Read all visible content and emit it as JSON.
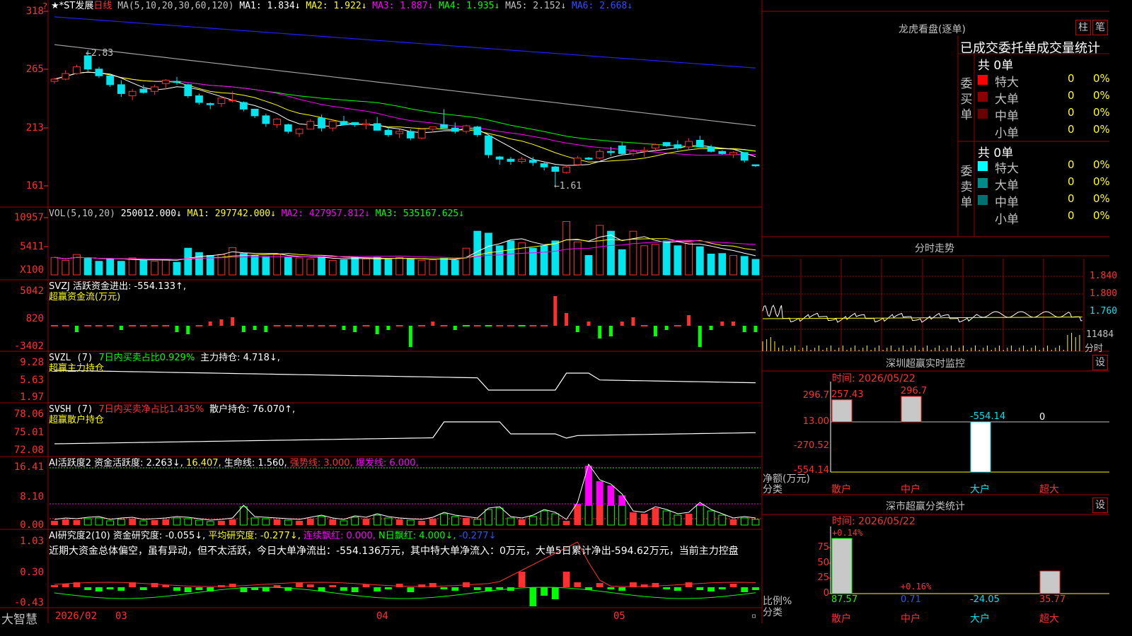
{
  "colors": {
    "up": "#ff3030",
    "down": "#00e5ee",
    "grid": "#9a0000",
    "yellow": "#ffff00",
    "magenta": "#ff00ff",
    "green": "#00ff00",
    "white": "#ffffff",
    "blue": "#2020ff",
    "gray": "#a0a0a0"
  },
  "header": {
    "stock_name": "★*ST发展",
    "period": "日线",
    "ma_label": "MA(5,10,20,30,60,120)",
    "ma1": "MA1: 1.834↓",
    "ma2": "MA2: 1.922↓",
    "ma3": "MA3: 1.887↓",
    "ma4": "MA4: 1.935↓",
    "ma5": "MA5: 2.152↓",
    "ma6": "MA6: 2.668↓"
  },
  "price_axis": [
    "318",
    "265",
    "213",
    "161"
  ],
  "price_annotations": {
    "high": "2.83",
    "low": "1.61"
  },
  "volume_panel": {
    "legend": "VOL(5,10,20)",
    "value": "250012.000↓",
    "ma1": "MA1: 297742.000↓",
    "ma2": "MA2: 427957.812↓",
    "ma3": "MA3: 535167.625↓",
    "axis": [
      "10957",
      "5411"
    ],
    "unit": "X100"
  },
  "svzj_panel": {
    "legend": "SVZJ  活跃资金进出: -554.133↑,",
    "sub": "超赢资金流(万元)",
    "axis": [
      "5042",
      "820",
      "-3402"
    ]
  },
  "svzl_panel": {
    "legend_a": "SVZL (7)",
    "legend_b": "7日内买卖占比0.929%",
    "legend_c": "主力持仓: 4.718↓,",
    "sub": "超赢主力持仓",
    "axis": [
      "9.28",
      "5.63",
      "1.97"
    ]
  },
  "svsh_panel": {
    "legend_a": "SVSH (7)",
    "legend_b": "7日内买卖净占比1.435%",
    "legend_c": "散户持仓: 76.070↑,",
    "sub": "超赢散户持仓",
    "axis": [
      "78.06",
      "75.01",
      "72.08"
    ]
  },
  "ai_active_panel": {
    "legend_a": "AI活跃度2",
    "legend_b": "资金活跃度: 2.263↓,",
    "legend_c": "16.407,",
    "legend_d": "生命线: 1.560,",
    "legend_e": "强势线: 3.000,",
    "legend_f": "爆发线: 6.000,",
    "axis": [
      "16.41",
      "8.10",
      "0.00"
    ]
  },
  "ai_research_panel": {
    "legend_a": "AI研究度2(10)",
    "legend_b": "资金研究度: -0.055↓,",
    "legend_c": "平均研究度: -0.277↓,",
    "legend_d": "连续飘红: 0.000,",
    "legend_e": "N日飘红: 4.000↓,",
    "legend_f": "-0.277↓",
    "comment": "近期大资金总体偏空，虽有异动，但不太活跃，今日大单净流出：-554.136万元，其中特大单净流入：0万元，大单5日累计净出-594.62万元，当前主力控盘",
    "axis": [
      "1.03",
      "0.30",
      "-0.43"
    ]
  },
  "date_axis": {
    "brand": "大智慧",
    "labels": [
      "2026/02",
      "03",
      "04",
      "05"
    ]
  },
  "dragon_tiger": {
    "title": "龙虎看盘(逐单)",
    "btn_a": "柱",
    "btn_b": "笔",
    "header": "已成交委托单成交量统计",
    "buy_label": "委买单",
    "sell_label": "委卖单",
    "buy_total": "共 0单",
    "sell_total": "共 0单",
    "buy_rows": [
      {
        "label": "特大",
        "value": "0",
        "pct": "0%",
        "color": "#ff0000"
      },
      {
        "label": "大单",
        "value": "0",
        "pct": "0%",
        "color": "#8b0000"
      },
      {
        "label": "中单",
        "value": "0",
        "pct": "0%",
        "color": "#6b0000"
      },
      {
        "label": "小单",
        "value": "0",
        "pct": "0%",
        "color": "#000000"
      }
    ],
    "sell_rows": [
      {
        "label": "特大",
        "value": "0",
        "pct": "0%",
        "color": "#00ffff"
      },
      {
        "label": "大单",
        "value": "0",
        "pct": "0%",
        "color": "#008b8b"
      },
      {
        "label": "中单",
        "value": "0",
        "pct": "0%",
        "color": "#007070"
      },
      {
        "label": "小单",
        "value": "0",
        "pct": "0%",
        "color": "#000000"
      }
    ]
  },
  "intraday": {
    "title": "分时走势",
    "price_axis": [
      "1.840",
      "1.800",
      "1.760"
    ],
    "vol_label": "11484",
    "unit": "分时"
  },
  "sz_monitor": {
    "title": "深圳超赢实时监控",
    "btn": "设",
    "time": "时间: 2026/05/22",
    "axis": [
      "296.7",
      "13.00",
      "-270.52",
      "-554.14"
    ],
    "ylabel": "净额(万元)",
    "xlabel": "分类",
    "categories": [
      "散户",
      "中户",
      "大户",
      "超大"
    ],
    "values": [
      257.43,
      296.7,
      -554.14,
      0
    ],
    "value_labels": [
      "257.43",
      "296.7",
      "-554.14",
      "0"
    ]
  },
  "sz_classify": {
    "title": "深市超赢分类统计",
    "btn": "设",
    "time": "时间: 2026/05/22",
    "axis": [
      "75",
      "50",
      "25",
      "0"
    ],
    "ylabel": "比例%",
    "xlabel": "分类",
    "categories": [
      "散户",
      "中户",
      "大户",
      "超大"
    ],
    "values": [
      87.57,
      0.71,
      -24.05,
      35.77
    ],
    "value_labels": [
      "87.57",
      "0.71",
      "-24.05",
      "35.77"
    ],
    "annot_a": "+0.14%",
    "annot_b": "+0.16%"
  },
  "chart_data": {
    "type": "candlestick",
    "title": "★*ST发展 日线",
    "x_range": [
      "2026/02",
      "2026/05/22"
    ],
    "price_ylim": [
      1.61,
      3.18
    ],
    "ohlc": [
      [
        2.55,
        2.58,
        2.53,
        2.57
      ],
      [
        2.57,
        2.65,
        2.56,
        2.62
      ],
      [
        2.62,
        2.7,
        2.61,
        2.68
      ],
      [
        2.78,
        2.83,
        2.64,
        2.66
      ],
      [
        2.66,
        2.68,
        2.58,
        2.6
      ],
      [
        2.6,
        2.62,
        2.5,
        2.52
      ],
      [
        2.52,
        2.56,
        2.41,
        2.44
      ],
      [
        2.42,
        2.48,
        2.38,
        2.46
      ],
      [
        2.48,
        2.52,
        2.44,
        2.45
      ],
      [
        2.46,
        2.52,
        2.43,
        2.5
      ],
      [
        2.53,
        2.57,
        2.48,
        2.56
      ],
      [
        2.55,
        2.59,
        2.52,
        2.54
      ],
      [
        2.52,
        2.53,
        2.4,
        2.42
      ],
      [
        2.42,
        2.44,
        2.34,
        2.36
      ],
      [
        2.35,
        2.36,
        2.3,
        2.34
      ],
      [
        2.35,
        2.42,
        2.32,
        2.4
      ],
      [
        2.38,
        2.46,
        2.36,
        2.38
      ],
      [
        2.36,
        2.37,
        2.28,
        2.3
      ],
      [
        2.3,
        2.3,
        2.22,
        2.24
      ],
      [
        2.24,
        2.26,
        2.14,
        2.17
      ],
      [
        2.16,
        2.22,
        2.13,
        2.21
      ],
      [
        2.16,
        2.17,
        2.08,
        2.1
      ],
      [
        2.08,
        2.13,
        2.05,
        2.12
      ],
      [
        2.12,
        2.21,
        2.12,
        2.19
      ],
      [
        2.22,
        2.25,
        2.1,
        2.13
      ],
      [
        2.13,
        2.21,
        2.1,
        2.19
      ],
      [
        2.19,
        2.24,
        2.16,
        2.16
      ],
      [
        2.18,
        2.18,
        2.14,
        2.16
      ],
      [
        2.16,
        2.21,
        2.12,
        2.17
      ],
      [
        2.17,
        2.23,
        2.14,
        2.11
      ],
      [
        2.11,
        2.14,
        2.05,
        2.07
      ],
      [
        2.08,
        2.12,
        2.04,
        2.1
      ],
      [
        2.1,
        2.12,
        2.02,
        2.04
      ],
      [
        2.04,
        2.12,
        2.03,
        2.12
      ],
      [
        2.12,
        2.14,
        2.09,
        2.14
      ],
      [
        2.16,
        2.3,
        2.14,
        2.13
      ],
      [
        2.13,
        2.18,
        2.08,
        2.1
      ],
      [
        2.1,
        2.16,
        2.08,
        2.15
      ],
      [
        2.14,
        2.15,
        2.05,
        2.07
      ],
      [
        2.06,
        2.06,
        1.86,
        1.89
      ],
      [
        1.87,
        1.88,
        1.8,
        1.85
      ],
      [
        1.85,
        1.87,
        1.8,
        1.83
      ],
      [
        1.83,
        1.87,
        1.81,
        1.85
      ],
      [
        1.84,
        1.87,
        1.79,
        1.82
      ],
      [
        1.81,
        1.83,
        1.75,
        1.78
      ],
      [
        1.78,
        1.79,
        1.61,
        1.74
      ],
      [
        1.73,
        1.8,
        1.72,
        1.78
      ],
      [
        1.8,
        1.88,
        1.79,
        1.86
      ],
      [
        1.86,
        1.87,
        1.84,
        1.85
      ],
      [
        1.86,
        1.94,
        1.85,
        1.92
      ],
      [
        1.92,
        1.96,
        1.88,
        1.91
      ],
      [
        1.97,
        2.0,
        1.89,
        1.9
      ],
      [
        1.9,
        1.94,
        1.88,
        1.92
      ],
      [
        1.92,
        1.96,
        1.87,
        1.93
      ],
      [
        1.95,
        1.99,
        1.92,
        1.98
      ],
      [
        2.0,
        2.0,
        1.96,
        1.97
      ],
      [
        1.98,
        2.02,
        1.93,
        1.95
      ],
      [
        1.96,
        2.04,
        1.94,
        2.01
      ],
      [
        2.02,
        2.06,
        1.98,
        1.96
      ],
      [
        1.96,
        1.98,
        1.91,
        1.92
      ],
      [
        1.92,
        1.93,
        1.89,
        1.9
      ],
      [
        1.89,
        1.92,
        1.86,
        1.91
      ],
      [
        1.91,
        1.91,
        1.82,
        1.84
      ],
      [
        1.8,
        1.8,
        1.78,
        1.79
      ]
    ],
    "volume": [
      36,
      30,
      42,
      34,
      28,
      33,
      28,
      35,
      30,
      28,
      32,
      26,
      55,
      46,
      40,
      42,
      56,
      44,
      40,
      38,
      42,
      36,
      35,
      33,
      38,
      30,
      31,
      36,
      33,
      36,
      32,
      36,
      33,
      30,
      31,
      34,
      30,
      55,
      90,
      86,
      60,
      70,
      66,
      55,
      60,
      70,
      110,
      68,
      40,
      102,
      90,
      52,
      90,
      60,
      63,
      70,
      60,
      66,
      58,
      43,
      44,
      40,
      38,
      32
    ],
    "ma_values": {
      "MA1": 1.834,
      "MA2": 1.922,
      "MA3": 1.887,
      "MA4": 1.935,
      "MA5": 2.152,
      "MA6": 2.668
    }
  }
}
